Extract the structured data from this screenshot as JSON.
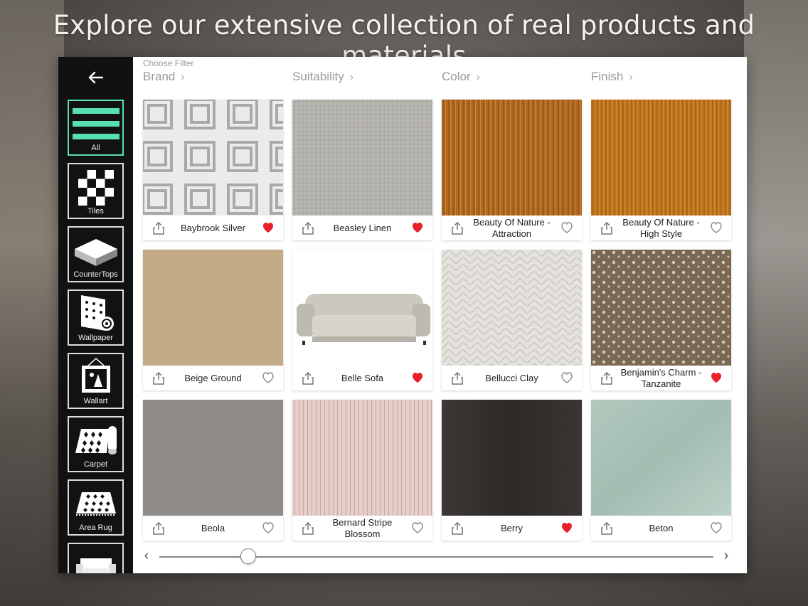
{
  "headline": "Explore our extensive collection of real products and materials",
  "sidebar": {
    "back_icon": "arrow-left-icon",
    "categories": [
      {
        "label": "All",
        "icon": "list-icon",
        "active": true
      },
      {
        "label": "Tiles",
        "icon": "checker-tiles-icon",
        "active": false
      },
      {
        "label": "CounterTops",
        "icon": "countertop-slab-icon",
        "active": false
      },
      {
        "label": "Wallpaper",
        "icon": "wallpaper-roll-icon",
        "active": false
      },
      {
        "label": "Wallart",
        "icon": "framed-art-icon",
        "active": false
      },
      {
        "label": "Carpet",
        "icon": "carpet-roll-icon",
        "active": false
      },
      {
        "label": "Area Rug",
        "icon": "area-rug-icon",
        "active": false
      },
      {
        "label": "",
        "icon": "sofa-icon",
        "active": false
      }
    ]
  },
  "filters": {
    "caption": "Choose Filter",
    "items": [
      {
        "label": "Brand"
      },
      {
        "label": "Suitability"
      },
      {
        "label": "Color"
      },
      {
        "label": "Finish"
      }
    ]
  },
  "products": [
    {
      "name": "Baybrook Silver",
      "favorite": true,
      "swatch": "geometric-gray"
    },
    {
      "name": "Beasley Linen",
      "favorite": true,
      "swatch": "linen-gray"
    },
    {
      "name": "Beauty Of Nature - Attraction",
      "favorite": false,
      "swatch": "grasscloth-amber"
    },
    {
      "name": "Beauty Of Nature - High Style",
      "favorite": false,
      "swatch": "grasscloth-orange"
    },
    {
      "name": "Beige Ground",
      "favorite": false,
      "swatch": "beige"
    },
    {
      "name": "Belle Sofa",
      "favorite": true,
      "swatch": "sofa"
    },
    {
      "name": "Bellucci Clay",
      "favorite": false,
      "swatch": "herringbone-cream"
    },
    {
      "name": "Benjamin's Charm - Tanzanite",
      "favorite": true,
      "swatch": "dots-brown"
    },
    {
      "name": "Beola",
      "favorite": false,
      "swatch": "gray-felt"
    },
    {
      "name": "Bernard Stripe Blossom",
      "favorite": false,
      "swatch": "pink-stripe"
    },
    {
      "name": "Berry",
      "favorite": true,
      "swatch": "dark-wood"
    },
    {
      "name": "Beton",
      "favorite": false,
      "swatch": "mint-plaster"
    }
  ],
  "scroller": {
    "position": 0.16
  },
  "colors": {
    "accent": "#58e0b4",
    "heart_active": "#e8202a"
  }
}
